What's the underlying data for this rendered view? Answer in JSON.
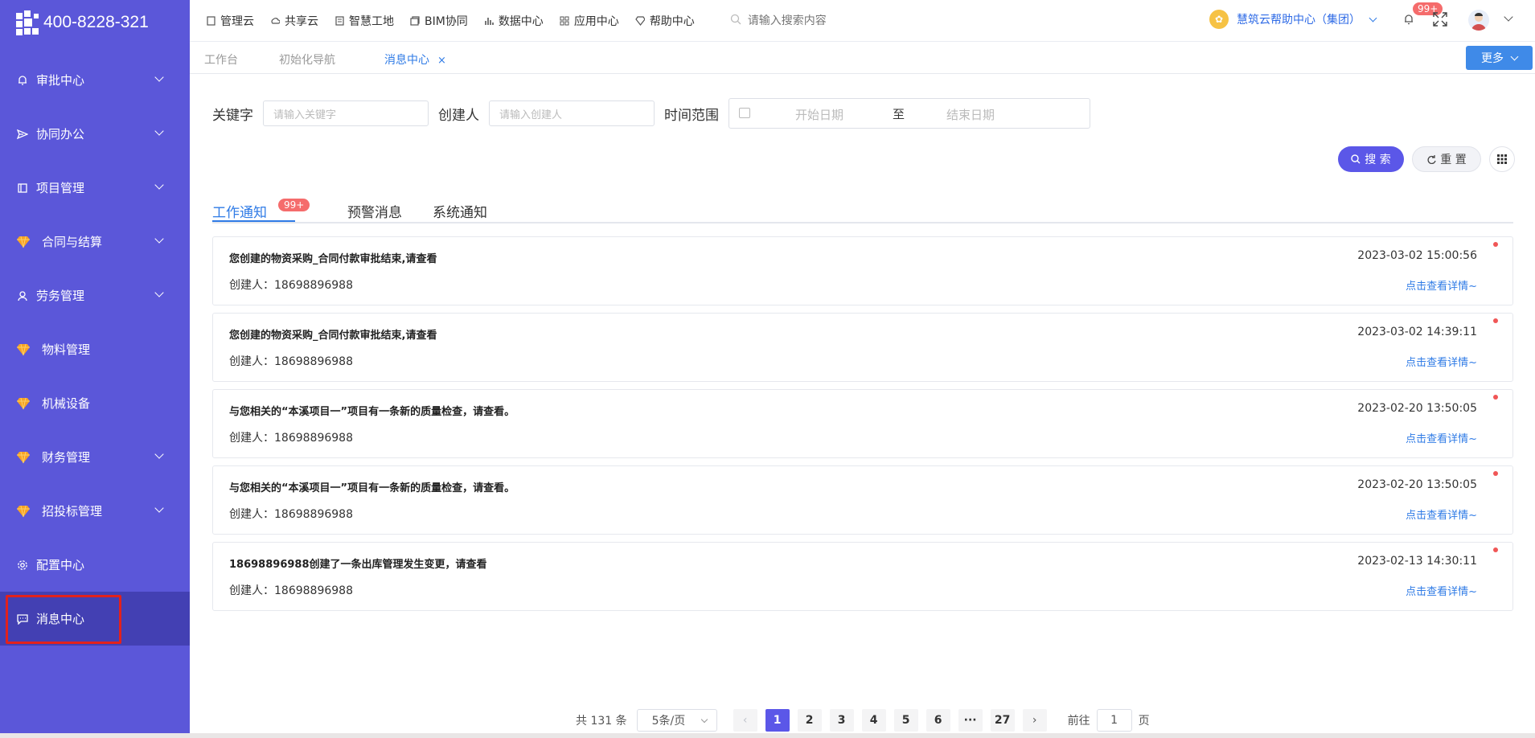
{
  "brand": {
    "phone": "400-8228-321"
  },
  "sidebar": {
    "items": [
      {
        "label": "审批中心",
        "icon": "bell-icon",
        "has_children": true
      },
      {
        "label": "协同办公",
        "icon": "send-icon",
        "has_children": true
      },
      {
        "label": "项目管理",
        "icon": "book-icon",
        "has_children": true
      },
      {
        "label": "合同与结算",
        "icon": "gem-icon",
        "has_children": true
      },
      {
        "label": "劳务管理",
        "icon": "worker-icon",
        "has_children": true
      },
      {
        "label": "物料管理",
        "icon": "gem-icon",
        "has_children": false
      },
      {
        "label": "机械设备",
        "icon": "gem-icon",
        "has_children": false
      },
      {
        "label": "财务管理",
        "icon": "gem-icon",
        "has_children": true
      },
      {
        "label": "招投标管理",
        "icon": "gem-icon",
        "has_children": true
      },
      {
        "label": "配置中心",
        "icon": "gear-icon",
        "has_children": false
      },
      {
        "label": "消息中心",
        "icon": "message-icon",
        "has_children": false,
        "active": true
      }
    ]
  },
  "topnav": {
    "items": [
      "管理云",
      "共享云",
      "智慧工地",
      "BIM协同",
      "数据中心",
      "应用中心",
      "帮助中心"
    ],
    "search_placeholder": "请输入搜索内容",
    "help_center": "慧筑云帮助中心（集团）",
    "notification_badge": "99+"
  },
  "page_tabs": {
    "items": [
      "工作台",
      "初始化导航",
      "消息中心"
    ],
    "close_symbol": "×",
    "more_label": "更多"
  },
  "filters": {
    "keyword_label": "关键字",
    "keyword_placeholder": "请输入关键字",
    "creator_label": "创建人",
    "creator_placeholder": "请输入创建人",
    "time_label": "时间范围",
    "start_placeholder": "开始日期",
    "range_sep": "至",
    "end_placeholder": "结束日期",
    "search_button": "搜 索",
    "reset_button": "重 置"
  },
  "message_tabs": {
    "items": [
      "工作通知",
      "预警消息",
      "系统通知"
    ],
    "badge": "99+"
  },
  "messages": [
    {
      "title": "您创建的物资采购_合同付款审批结束,请查看",
      "time": "2023-03-02 15:00:56",
      "creator": "创建人：18698896988",
      "detail": "点击查看详情~"
    },
    {
      "title": "您创建的物资采购_合同付款审批结束,请查看",
      "time": "2023-03-02 14:39:11",
      "creator": "创建人：18698896988",
      "detail": "点击查看详情~"
    },
    {
      "title": "与您相关的“本溪项目一”项目有一条新的质量检查，请查看。",
      "time": "2023-02-20 13:50:05",
      "creator": "创建人：18698896988",
      "detail": "点击查看详情~"
    },
    {
      "title": "与您相关的“本溪项目一”项目有一条新的质量检查，请查看。",
      "time": "2023-02-20 13:50:05",
      "creator": "创建人：18698896988",
      "detail": "点击查看详情~"
    },
    {
      "title": "18698896988创建了一条出库管理发生变更，请查看",
      "time": "2023-02-13 14:30:11",
      "creator": "创建人：18698896988",
      "detail": "点击查看详情~"
    }
  ],
  "pagination": {
    "total": "共 131 条",
    "page_size": "5条/页",
    "pages": [
      "1",
      "2",
      "3",
      "4",
      "5",
      "6",
      "···",
      "27"
    ],
    "current": "1",
    "goto_label": "前往",
    "goto_value": "1",
    "goto_suffix": "页"
  },
  "colors": {
    "sidebar_bg": "#5b57d9",
    "sidebar_active": "#4340b3",
    "accent": "#5b57e8",
    "link": "#2f7be6",
    "badge": "#f56c6c"
  }
}
